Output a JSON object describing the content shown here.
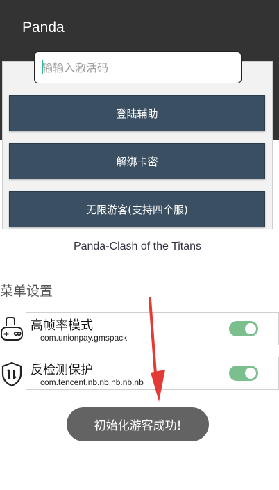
{
  "appbar": {
    "title": "Panda",
    "background": "#333333"
  },
  "activation": {
    "placeholder": "输输入激活码"
  },
  "buttons": {
    "login": "登陆辅助",
    "unbind": "解绑卡密",
    "guest": "无限游客(支持四个服)"
  },
  "subtitle": "Panda-Clash of the Titans",
  "menu": {
    "heading": "菜单设置",
    "items": [
      {
        "title": "高帧率模式",
        "package": "com.unionpay.gmspack",
        "icon": "gamepad-icon",
        "enabled": true
      },
      {
        "title": "反检测保护",
        "package": "com.tencent.nb.nb.nb.nb.nb",
        "icon": "shield-icon",
        "enabled": true
      }
    ]
  },
  "toast": {
    "message": "初始化游客成功!"
  },
  "colors": {
    "button": "#3a4f62",
    "toggle": "#7cbf8e",
    "annotation_arrow": "#e53935",
    "toast": "#636363"
  }
}
